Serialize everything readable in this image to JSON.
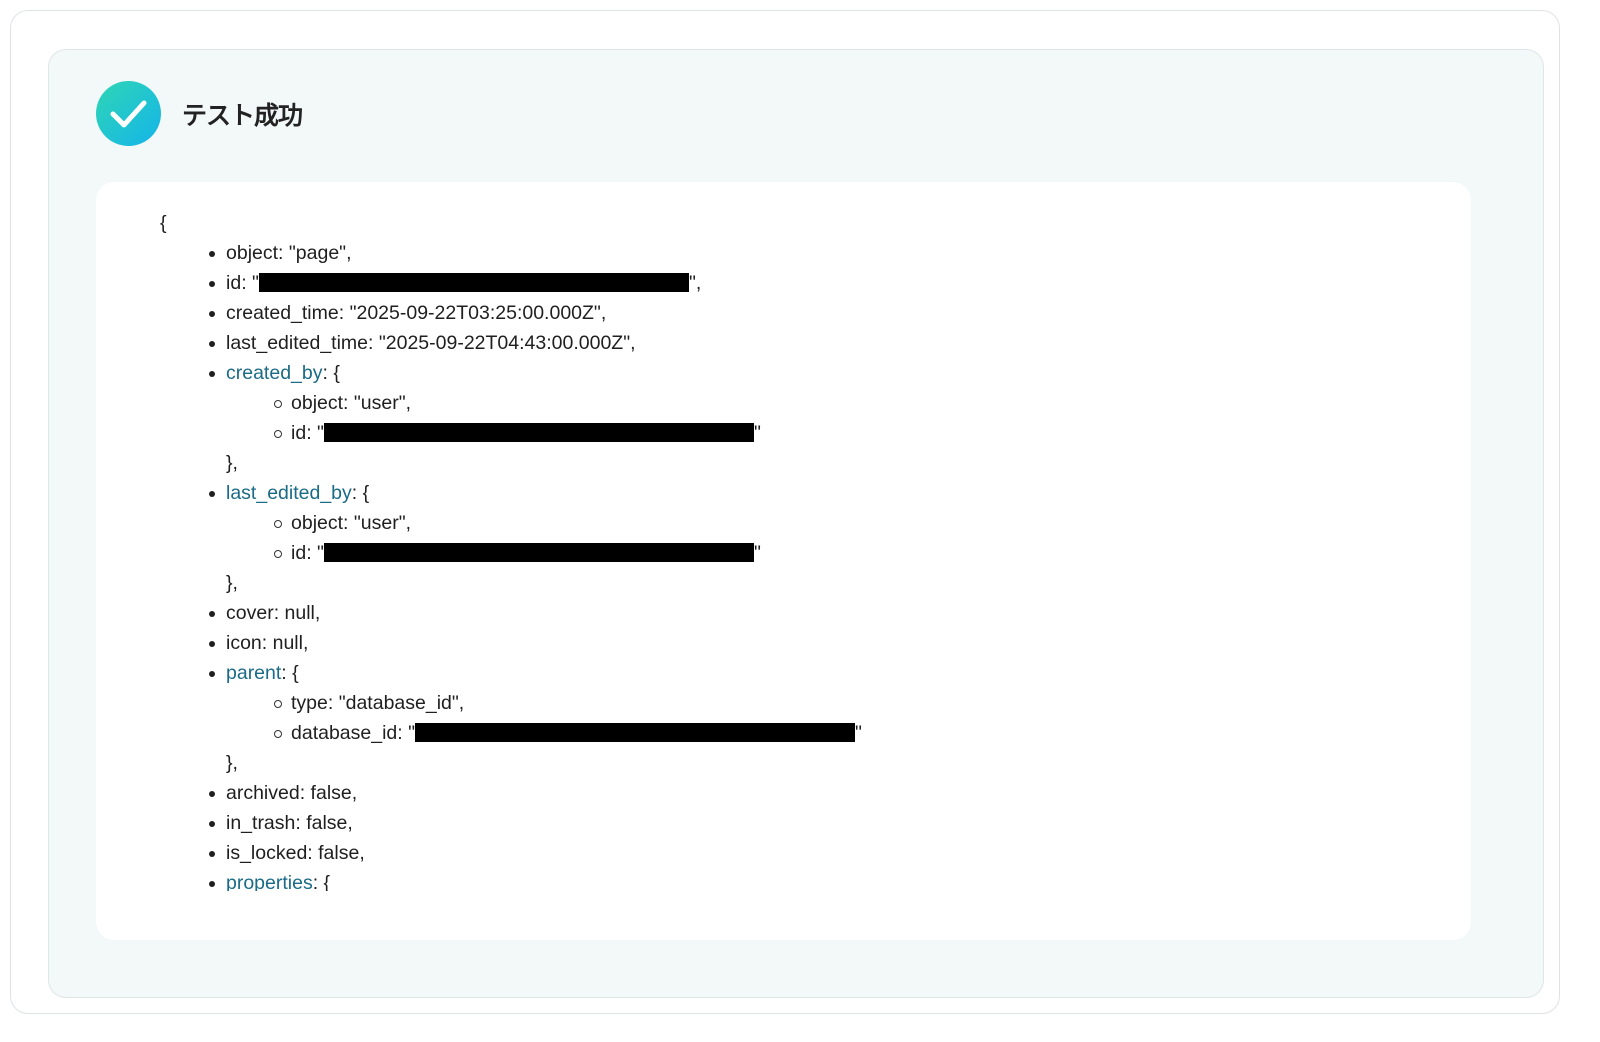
{
  "header": {
    "status_icon": "check-circle-icon",
    "title": "テスト成功",
    "accent_gradient": [
      "#2fd6b4",
      "#14b4ea"
    ]
  },
  "result": {
    "link_color": "#1a6b86",
    "lines": [
      {
        "level": 0,
        "text": "{"
      },
      {
        "level": 1,
        "key": "object",
        "rest": ": \"page\","
      },
      {
        "level": 1,
        "key": "id",
        "rest": ": \"",
        "redacted": true,
        "suffix": "\","
      },
      {
        "level": 1,
        "key": "created_time",
        "rest": ": \"2025-09-22T03:25:00.000Z\","
      },
      {
        "level": 1,
        "key": "last_edited_time",
        "rest": ": \"2025-09-22T04:43:00.000Z\","
      },
      {
        "level": 1,
        "key": "created_by",
        "link": true,
        "rest": ": {"
      },
      {
        "level": 2,
        "key": "object",
        "rest": ": \"user\","
      },
      {
        "level": 2,
        "key": "id",
        "rest": ": \"",
        "redacted": true,
        "suffix": "\""
      },
      {
        "level": 1.5,
        "text": "},"
      },
      {
        "level": 1,
        "key": "last_edited_by",
        "link": true,
        "rest": ": {"
      },
      {
        "level": 2,
        "key": "object",
        "rest": ": \"user\","
      },
      {
        "level": 2,
        "key": "id",
        "rest": ": \"",
        "redacted": true,
        "suffix": "\""
      },
      {
        "level": 1.5,
        "text": "},"
      },
      {
        "level": 1,
        "key": "cover",
        "rest": ": null,"
      },
      {
        "level": 1,
        "key": "icon",
        "rest": ": null,"
      },
      {
        "level": 1,
        "key": "parent",
        "link": true,
        "rest": ": {"
      },
      {
        "level": 2,
        "key": "type",
        "rest": ": \"database_id\","
      },
      {
        "level": 2,
        "key": "database_id",
        "rest": ": \"",
        "redacted": true,
        "suffix": "\""
      },
      {
        "level": 1.5,
        "text": "},"
      },
      {
        "level": 1,
        "key": "archived",
        "rest": ": false,"
      },
      {
        "level": 1,
        "key": "in_trash",
        "rest": ": false,"
      },
      {
        "level": 1,
        "key": "is_locked",
        "rest": ": false,"
      },
      {
        "level": 1,
        "key": "properties",
        "link": true,
        "rest": ": {"
      }
    ]
  }
}
